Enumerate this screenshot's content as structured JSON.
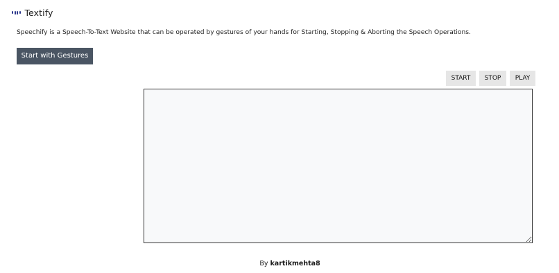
{
  "header": {
    "brand_icon": "equalizer-bars-icon",
    "brand_name": "Textify"
  },
  "intro": {
    "description": "Speechify is a Speech-To-Text Website that can be operated by gestures of your hands for Starting, Stopping & Aborting the Speech Operations.",
    "gesture_button_label": "Start with Gestures"
  },
  "controls": {
    "start_label": "START",
    "stop_label": "STOP",
    "play_label": "PLAY"
  },
  "transcript": {
    "value": ""
  },
  "footer": {
    "prefix": "By",
    "author": "kartikmehta8"
  },
  "colors": {
    "gesture_button_bg": "#4a5563",
    "control_button_bg": "#e6e6e6",
    "textarea_bg": "#f8f9fa",
    "brand_icon": "#2e3a8c"
  }
}
